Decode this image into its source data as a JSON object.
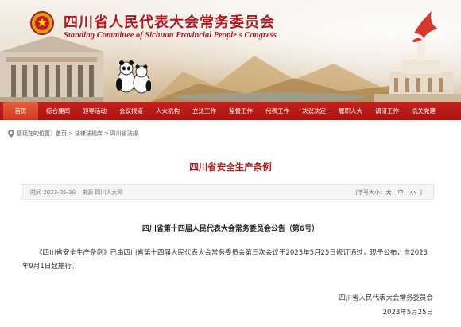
{
  "header": {
    "title": "四川省人民代表大会常务委员会",
    "subtitle": "Standing Committee of Sichuan Provincial People's Congress"
  },
  "nav": {
    "items": [
      {
        "label": "首页",
        "active": true
      },
      {
        "label": "综合要闻"
      },
      {
        "label": "领导活动"
      },
      {
        "label": "会议报道"
      },
      {
        "label": "人大机构"
      },
      {
        "label": "立法工作"
      },
      {
        "label": "监督工作"
      },
      {
        "label": "代表工作"
      },
      {
        "label": "决议决定"
      },
      {
        "label": "履职人大"
      },
      {
        "label": "调研工作"
      },
      {
        "label": "机关党建"
      }
    ]
  },
  "breadcrumb": {
    "prefix": "您现在的位置：",
    "items": [
      "首页",
      "法律法规库",
      "四川省法规"
    ],
    "separator": ">"
  },
  "article": {
    "title": "四川省安全生产条例",
    "date_label": "时间 2023-05-30",
    "source_label": "来源 四川人大网",
    "font_size_label": "[字号大小:",
    "font_sizes": [
      "大",
      "中",
      "小"
    ],
    "font_size_close": "]",
    "notice_title": "四川省第十四届人民代表大会常务委员会公告（第6号）",
    "body": "《四川省安全生产条例》已由四川省第十四届人民代表大会常务委员会第三次会议于2023年5月25日修订通过，现予公布，自2023年9月1日起施行。",
    "signature": "四川省人民代表大会常务委员会",
    "sign_date": "2023年5月25日"
  },
  "colors": {
    "brand_red": "#b5171b",
    "nav_red": "#c4221f",
    "nav_active": "#e85c3c"
  }
}
